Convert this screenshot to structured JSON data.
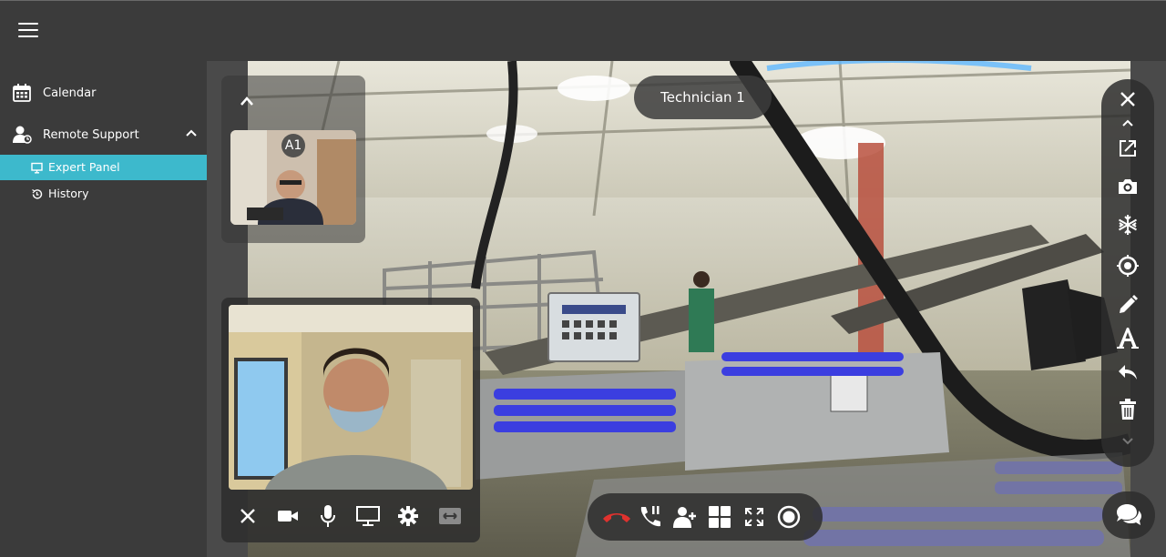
{
  "sidebar": {
    "items": [
      {
        "label": "Calendar",
        "icon": "calendar-icon"
      },
      {
        "label": "Remote Support",
        "icon": "user-support-icon",
        "expanded": true,
        "children": [
          {
            "label": "Expert Panel",
            "icon": "monitor-icon",
            "active": true
          },
          {
            "label": "History",
            "icon": "history-icon"
          }
        ]
      }
    ]
  },
  "main": {
    "participant_label": "Technician 1",
    "thumbnail_badge": "A1"
  },
  "colors": {
    "accent": "#3db9cc",
    "topbar": "#3b3b3b",
    "sidebar": "#3b3b3b",
    "hangup": "#e0322e"
  },
  "self_controls": [
    "close-icon",
    "camera-icon",
    "microphone-icon",
    "screen-share-icon",
    "settings-icon",
    "swap-icon"
  ],
  "call_controls": [
    "hangup-icon",
    "hold-call-icon",
    "add-user-icon",
    "grid-layout-icon",
    "fullscreen-icon",
    "record-icon"
  ],
  "annotation_tools": [
    "close-icon",
    "chevron-up-icon",
    "external-link-icon",
    "snapshot-icon",
    "freeze-icon",
    "pointer-icon",
    "pencil-icon",
    "text-icon",
    "undo-icon",
    "trash-icon",
    "chevron-down-icon"
  ]
}
